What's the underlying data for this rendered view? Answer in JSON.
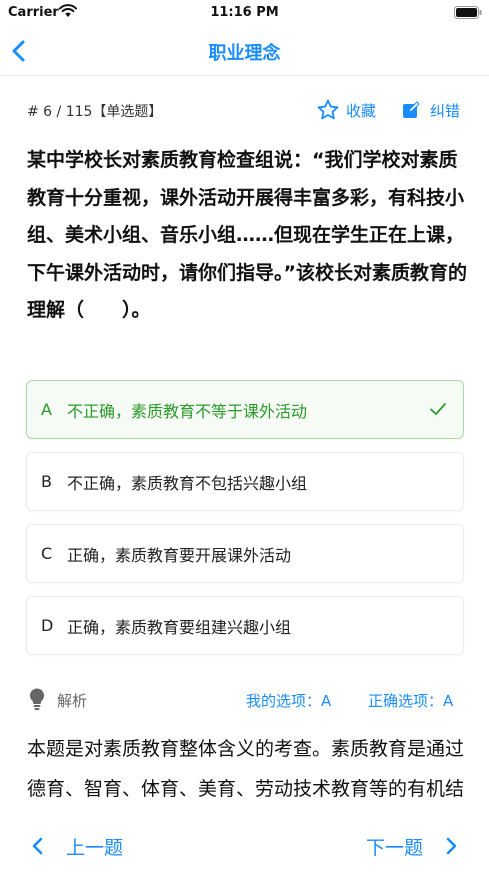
{
  "status_bar": {
    "carrier": "Carrier",
    "time": "11:16 PM"
  },
  "nav": {
    "title": "职业理念"
  },
  "question": {
    "meta": "# 6 / 115【单选题】",
    "text": "某中学校长对素质教育检查组说：“我们学校对素质教育十分重视，课外活动开展得丰富多彩，有科技小组、美术小组、音乐小组……但现在学生正在上课，下午课外活动时，请你们指导。”该校长对素质教育的理解（　　）。",
    "favorite_label": "收藏",
    "report_label": "纠错"
  },
  "options": [
    {
      "letter": "A",
      "text": "不正确，素质教育不等于课外活动"
    },
    {
      "letter": "B",
      "text": "不正确，素质教育不包括兴趣小组"
    },
    {
      "letter": "C",
      "text": "正确，素质教育要开展课外活动"
    },
    {
      "letter": "D",
      "text": "正确，素质教育要组建兴趣小组"
    }
  ],
  "analysis": {
    "label": "解析",
    "my_choice": "我的选项：A",
    "correct_choice": "正确选项：A",
    "text": "本题是对素质教育整体含义的考查。素质教育是通过德育、智育、体育、美育、劳动技术教育等的有机结合，来实现发展，一般……"
  },
  "footer": {
    "prev_label": "上一题",
    "next_label": "下一题"
  },
  "colors": {
    "accent": "#1a8cff",
    "correct": "#2a9a2a",
    "correct_border": "#a9d9a9"
  },
  "icons": {
    "back": "chevron-left-icon",
    "favorite": "star-outline-icon",
    "report": "edit-icon",
    "check": "check-icon",
    "bulb": "lightbulb-icon",
    "prev": "chevron-left-icon",
    "next": "chevron-right-icon"
  }
}
